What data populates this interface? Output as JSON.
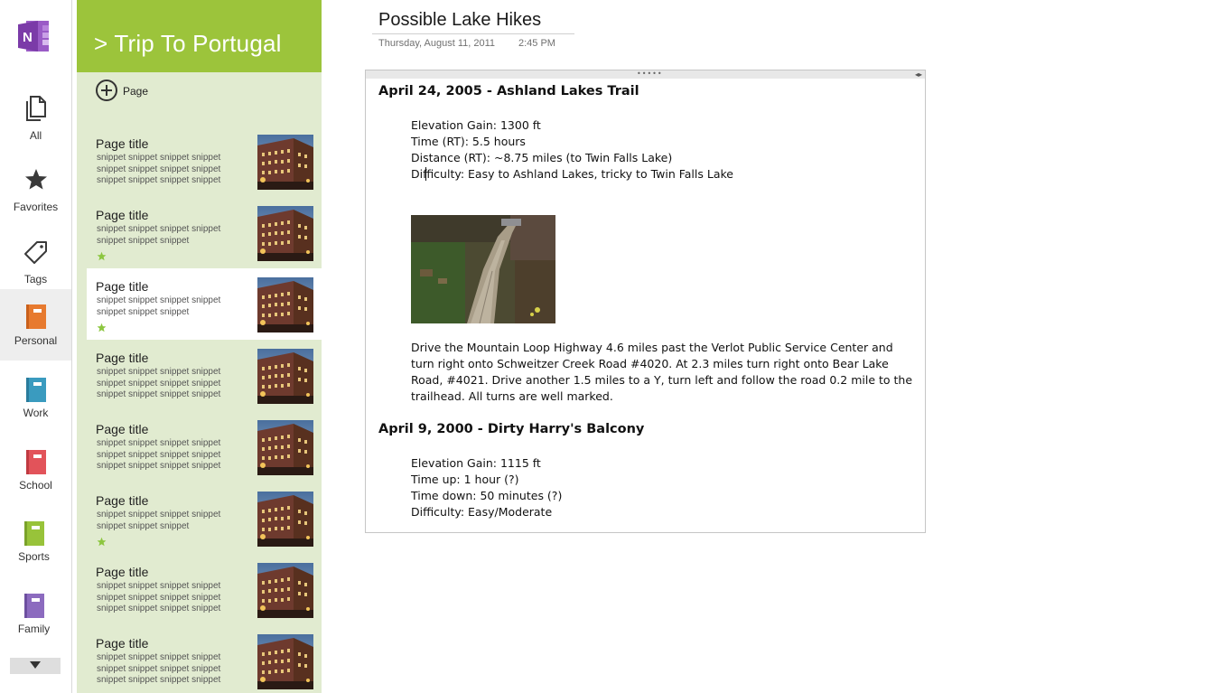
{
  "app": {
    "logo_letter": "N"
  },
  "colors": {
    "section_accent": "#9cc43b",
    "section_bg": "#e1ebd0",
    "star": "#8cc63f",
    "app_brand": "#7b3ba8"
  },
  "nav": {
    "items": [
      {
        "label": "All",
        "icon": "pages-icon"
      },
      {
        "label": "Favorites",
        "icon": "star-icon"
      },
      {
        "label": "Tags",
        "icon": "tag-icon"
      },
      {
        "label": "Personal",
        "icon": "notebook-icon",
        "color": "#e77a2f",
        "selected": true
      },
      {
        "label": "Work",
        "icon": "notebook-icon",
        "color": "#3a9bbf"
      },
      {
        "label": "School",
        "icon": "notebook-icon",
        "color": "#e2535a"
      },
      {
        "label": "Sports",
        "icon": "notebook-icon",
        "color": "#98c33a"
      },
      {
        "label": "Family",
        "icon": "notebook-icon",
        "color": "#8c6bbf"
      }
    ],
    "more_icon": "chevron-down-icon"
  },
  "section": {
    "title": "> Trip To Portugal",
    "add_page_label": "Page",
    "pages": [
      {
        "title": "Page title",
        "snippet": "snippet snippet snippet snippet snippet snippet snippet snippet snippet snippet snippet snippet",
        "favorite": false,
        "selected": false
      },
      {
        "title": "Page title",
        "snippet": "snippet snippet snippet snippet snippet snippet snippet",
        "favorite": true,
        "selected": false
      },
      {
        "title": "Page title",
        "snippet": "snippet snippet snippet snippet snippet snippet snippet",
        "favorite": true,
        "selected": true
      },
      {
        "title": "Page title",
        "snippet": "snippet snippet snippet snippet snippet snippet snippet snippet snippet snippet snippet snippet",
        "favorite": false,
        "selected": false
      },
      {
        "title": "Page title",
        "snippet": "snippet snippet snippet snippet snippet snippet snippet snippet snippet snippet snippet snippet",
        "favorite": false,
        "selected": false
      },
      {
        "title": "Page title",
        "snippet": "snippet snippet snippet snippet snippet snippet snippet",
        "favorite": true,
        "selected": false
      },
      {
        "title": "Page title",
        "snippet": "snippet snippet snippet snippet snippet snippet snippet snippet snippet snippet snippet snippet",
        "favorite": false,
        "selected": false
      },
      {
        "title": "Page title",
        "snippet": "snippet snippet snippet snippet snippet snippet snippet snippet snippet snippet snippet snippet",
        "favorite": false,
        "selected": false
      }
    ]
  },
  "page": {
    "title": "Possible Lake Hikes",
    "date": "Thursday, August 11, 2011",
    "time": "2:45 PM",
    "hikes": [
      {
        "heading": "April 24, 2005 - Ashland Lakes Trail",
        "details": [
          "Elevation Gain: 1300 ft",
          "Time (RT): 5.5 hours",
          "Distance (RT): ~8.75 miles (to Twin Falls Lake)",
          "Difficulty: Easy to Ashland Lakes, tricky to Twin Falls Lake"
        ],
        "directions": "Drive the Mountain Loop Highway 4.6 miles past the Verlot Public Service Center and turn right onto Schweitzer Creek Road #4020. At 2.3 miles turn right onto Bear Lake Road, #4021. Drive another 1.5 miles to a Y, turn left and follow the road 0.2 mile to the trailhead. All turns are well marked."
      },
      {
        "heading": "April 9, 2000 - Dirty Harry's Balcony",
        "details": [
          "Elevation Gain: 1115 ft",
          "Time up: 1 hour (?)",
          "Time down: 50 minutes (?)",
          "Difficulty: Easy/Moderate"
        ]
      }
    ]
  }
}
